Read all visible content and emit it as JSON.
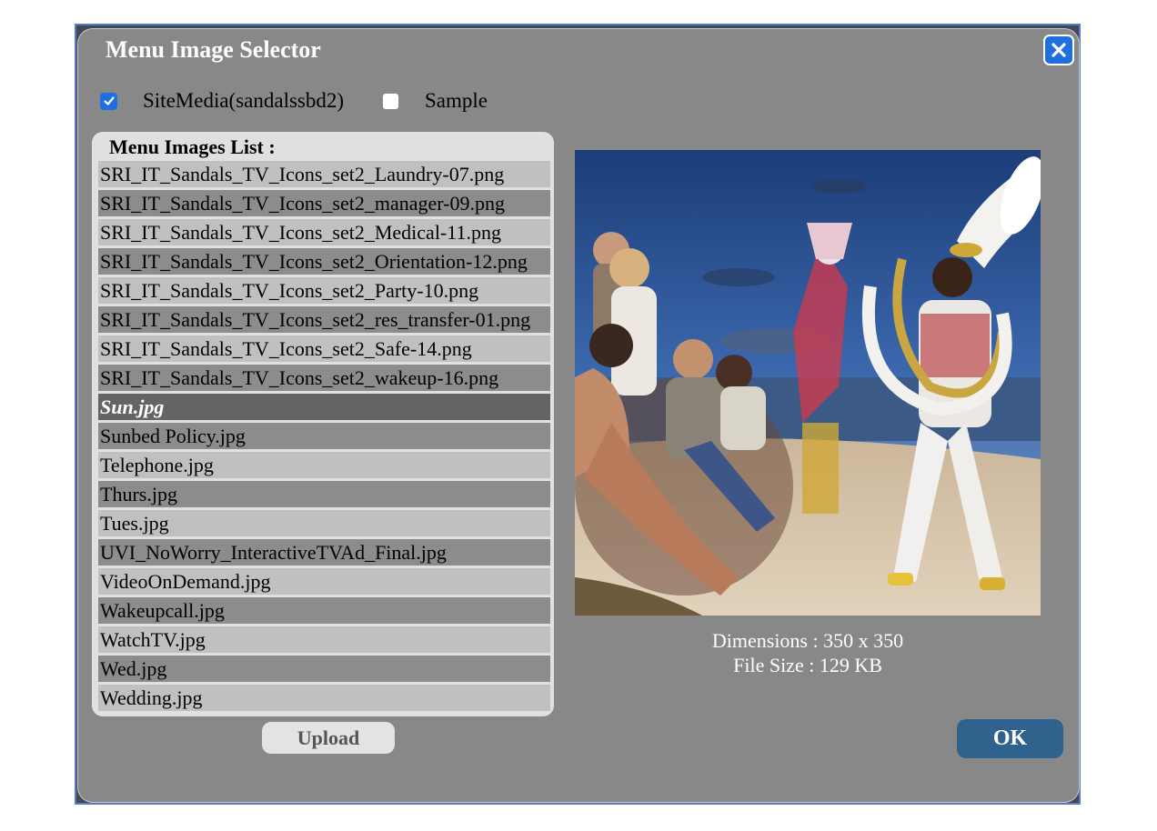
{
  "dialog": {
    "title": "Menu Image Selector",
    "close_icon": "close-icon"
  },
  "sources": [
    {
      "label": "SiteMedia(sandalssbd2)",
      "checked": true
    },
    {
      "label": "Sample",
      "checked": false
    }
  ],
  "list": {
    "header": "Menu Images List :",
    "items": [
      "SRI_IT_Sandals_TV_Icons_set2_Laundry-07.png",
      "SRI_IT_Sandals_TV_Icons_set2_manager-09.png",
      "SRI_IT_Sandals_TV_Icons_set2_Medical-11.png",
      "SRI_IT_Sandals_TV_Icons_set2_Orientation-12.png",
      "SRI_IT_Sandals_TV_Icons_set2_Party-10.png",
      "SRI_IT_Sandals_TV_Icons_set2_res_transfer-01.png",
      "SRI_IT_Sandals_TV_Icons_set2_Safe-14.png",
      "SRI_IT_Sandals_TV_Icons_set2_wakeup-16.png",
      "Sun.jpg",
      "Sunbed Policy.jpg",
      "Telephone.jpg",
      "Thurs.jpg",
      "Tues.jpg",
      "UVI_NoWorry_InteractiveTVAd_Final.jpg",
      "VideoOnDemand.jpg",
      "Wakeupcall.jpg",
      "WatchTV.jpg",
      "Wed.jpg",
      "Wedding.jpg"
    ],
    "selected_index": 8
  },
  "preview": {
    "dimensions": "Dimensions : 350 x 350",
    "file_size": "File Size : 129 KB"
  },
  "buttons": {
    "upload": "Upload",
    "ok": "OK"
  },
  "colors": {
    "accent": "#1f6fe0",
    "ok_button": "#30628e",
    "dialog_bg": "#888888"
  }
}
